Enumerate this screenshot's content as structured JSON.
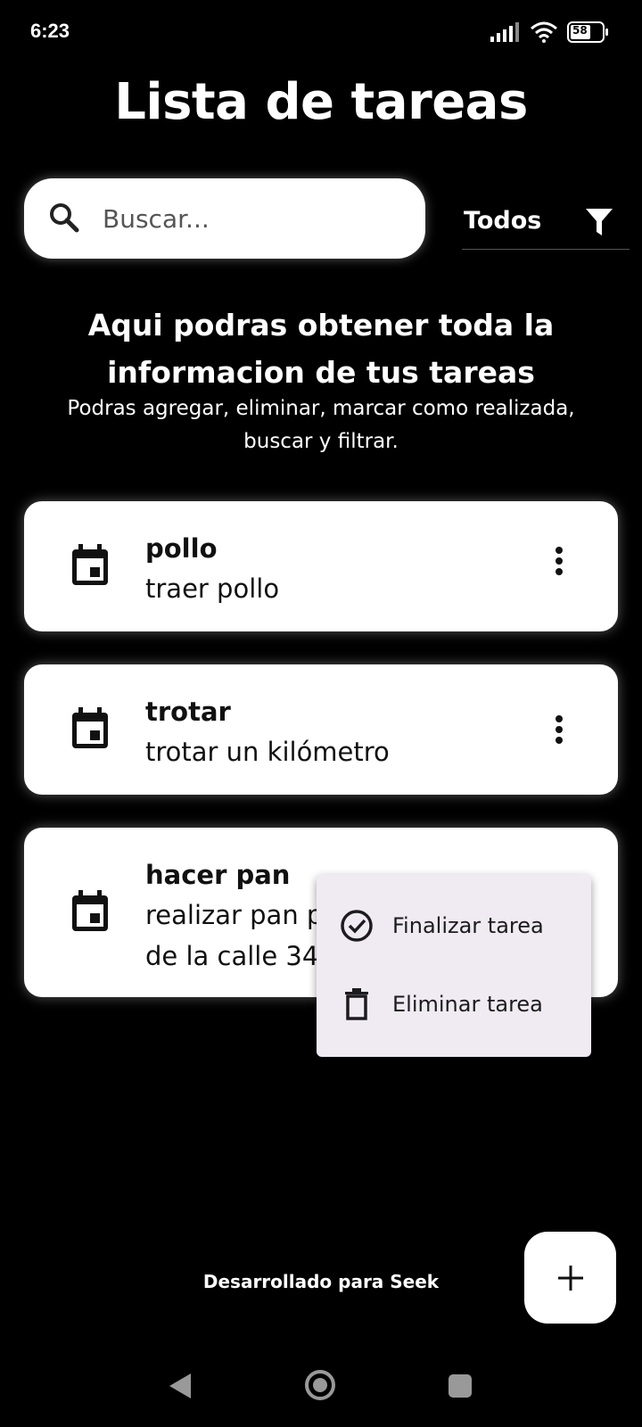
{
  "status_bar": {
    "time": "6:23",
    "battery_level": "58",
    "icons": [
      "signal-icon",
      "wifi-icon",
      "battery-icon"
    ]
  },
  "header": {
    "title": "Lista de tareas"
  },
  "search": {
    "placeholder": "Buscar..."
  },
  "filter": {
    "selected": "Todos",
    "icon": "filter-icon"
  },
  "intro": {
    "title": "Aqui podras obtener toda la informacion de tus tareas",
    "subtitle": "Podras agregar, eliminar, marcar como realizada, buscar y filtrar."
  },
  "tasks": [
    {
      "title": "pollo",
      "description": "traer pollo",
      "icon": "calendar-icon"
    },
    {
      "title": "trotar",
      "description": "trotar un kilómetro",
      "icon": "calendar-icon"
    },
    {
      "title": "hacer pan",
      "description_line1": "realizar pan p",
      "description_line2": "de la calle 34",
      "icon": "calendar-icon"
    }
  ],
  "context_menu": {
    "items": [
      {
        "label": "Finalizar tarea",
        "icon": "check-circle-icon"
      },
      {
        "label": "Eliminar tarea",
        "icon": "trash-icon"
      }
    ]
  },
  "footer": {
    "text": "Desarrollado para Seek"
  },
  "fab": {
    "icon": "plus-icon"
  },
  "nav": {
    "icons": [
      "back-icon",
      "home-icon",
      "recents-icon"
    ]
  },
  "colors": {
    "background": "#000000",
    "card": "#ffffff",
    "menu": "#f0eaf2"
  }
}
